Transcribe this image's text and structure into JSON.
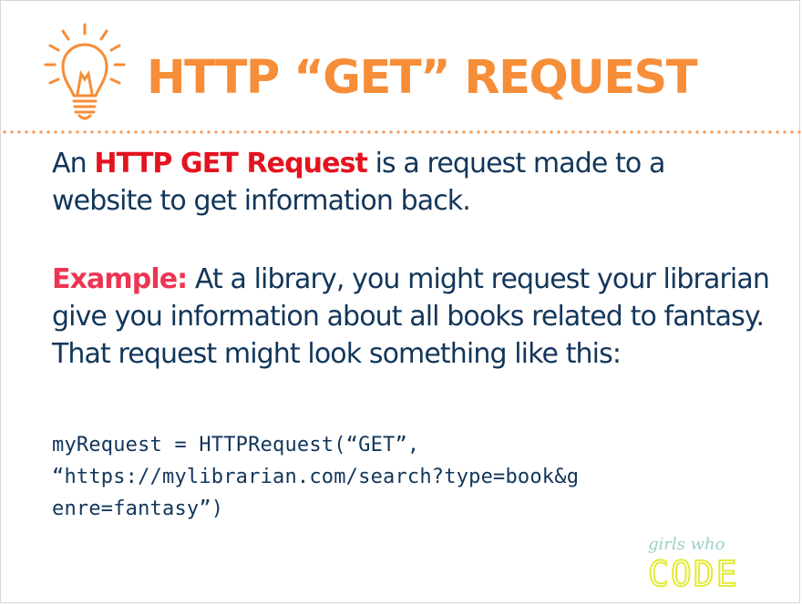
{
  "slide": {
    "title": "HTTP “GET” REQUEST",
    "intro": {
      "prefix": "An ",
      "highlight": "HTTP GET Request",
      "suffix": " is a request made to a website to get information back."
    },
    "example": {
      "label": "Example:",
      "text": " At a library, you might request your librarian give you information about all books related to fantasy. That request might look something like this:"
    },
    "code_lines": [
      "myRequest = HTTPRequest(“GET”,",
      "“https://mylibrarian.com/search?type=book&g",
      "enre=fantasy”)"
    ]
  },
  "logo": {
    "top": "girls who",
    "bottom": "CODE"
  },
  "icons": {
    "bulb": "lightbulb-icon"
  },
  "colors": {
    "title": "#f68d38",
    "body_text": "#12365a",
    "highlight_red": "#e3141f",
    "highlight_pink": "#ec3552",
    "divider": "#f4a468",
    "logo_top": "#9bcfc9",
    "logo_bottom": "#e5ea3b"
  }
}
